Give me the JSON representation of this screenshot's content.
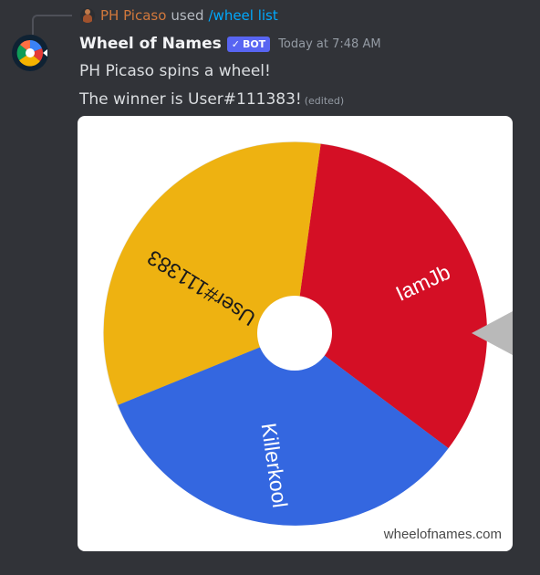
{
  "reply": {
    "user": "PH Picaso",
    "verb": "used",
    "command": "/wheel list"
  },
  "message": {
    "author": "Wheel of Names",
    "badge": "BOT",
    "timestamp": "Today at 7:48 AM",
    "line1": "PH Picaso spins a wheel!",
    "line2": "The winner is User#111383!",
    "edited": "(edited)"
  },
  "wheel": {
    "segments": [
      {
        "label": "IamJb",
        "color": "#d40f25"
      },
      {
        "label": "Killerkool",
        "color": "#3467e0"
      },
      {
        "label": "User#111383",
        "color": "#eeb211"
      }
    ],
    "watermark": "wheelofnames.com"
  },
  "colors": {
    "background": "#313338",
    "link": "#00a8fc",
    "reply_user": "#d1783c",
    "bot_badge": "#5865f2"
  },
  "icons": {
    "star": "star-icon",
    "pointer": "pointer-arrow-icon"
  }
}
